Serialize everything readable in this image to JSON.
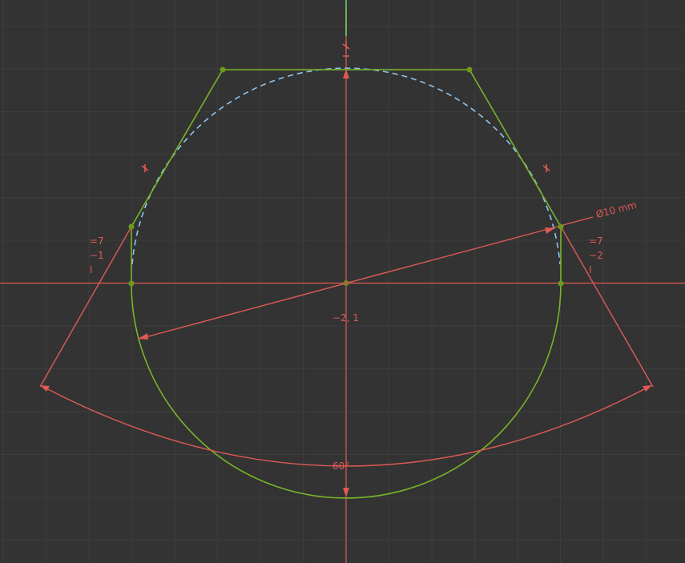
{
  "colors": {
    "background": "#333333",
    "grid": "#3d3d3d",
    "axis": "#e05a55",
    "geometry": "#79b428",
    "construction": "#8ec5f0",
    "y_axis_top": "#7dff7d",
    "points": "#6e9a1c",
    "dimension_text": "#e05a55"
  },
  "dimensions": {
    "diameter": "Ø10 mm",
    "angle": "60°"
  },
  "constraints": {
    "left_block": [
      "=7",
      "−1",
      "I"
    ],
    "right_block": [
      "=7",
      "−2",
      "I"
    ],
    "center": "−2, 1"
  },
  "icons": {
    "tangent_marker": "tangent-icon",
    "vertical_marker": "vertical-constraint-icon"
  }
}
